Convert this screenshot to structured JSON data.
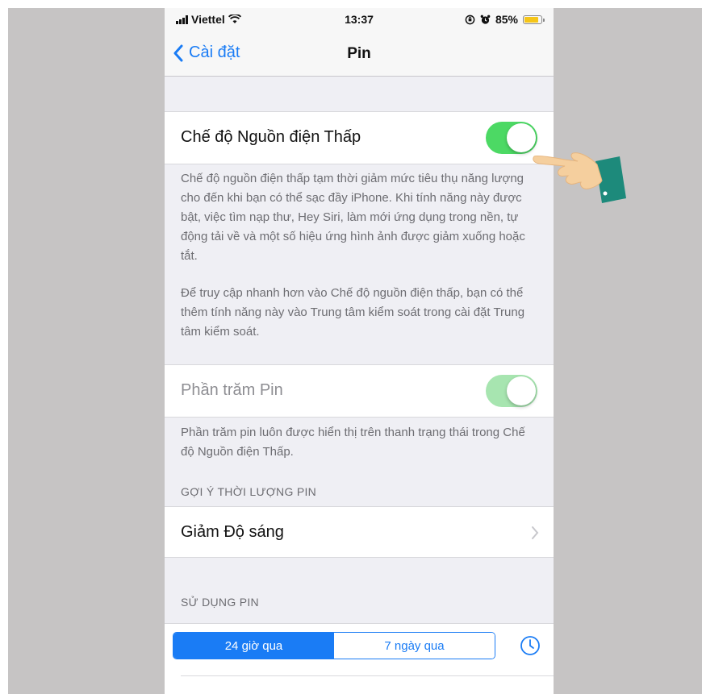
{
  "status_bar": {
    "carrier": "Viettel",
    "time": "13:37",
    "battery_percent": "85%",
    "battery_level": 0.85
  },
  "nav": {
    "back_label": "Cài đặt",
    "title": "Pin"
  },
  "low_power": {
    "label": "Chế độ Nguồn điện Thấp",
    "enabled": true,
    "description_1": "Chế độ nguồn điện thấp tạm thời giảm mức tiêu thụ năng lượng cho đến khi bạn có thể sạc đầy iPhone. Khi tính năng này được bật, việc tìm nạp thư, Hey Siri, làm mới ứng dụng trong nền, tự động tải về và một số hiệu ứng hình ảnh được giảm xuống hoặc tắt.",
    "description_2": "Để truy cập nhanh hơn vào Chế độ nguồn điện thấp, bạn có thể thêm tính năng này vào Trung tâm kiểm soát trong cài đặt Trung tâm kiểm soát."
  },
  "battery_percentage": {
    "label": "Phần trăm Pin",
    "enabled": true,
    "description": "Phần trăm pin luôn được hiển thị trên thanh trạng thái trong Chế độ Nguồn điện Thấp."
  },
  "suggestions": {
    "header": "GỢI Ý THỜI LƯỢNG PIN",
    "item_label": "Giảm Độ sáng"
  },
  "usage": {
    "header": "SỬ DỤNG PIN",
    "segments": [
      "24 giờ qua",
      "7 ngày qua"
    ],
    "selected_segment": "24 giờ qua"
  },
  "colors": {
    "accent": "#1a7cf5",
    "toggle_on": "#4cd964",
    "background": "#efeff4",
    "backdrop": "#c6c4c4"
  }
}
